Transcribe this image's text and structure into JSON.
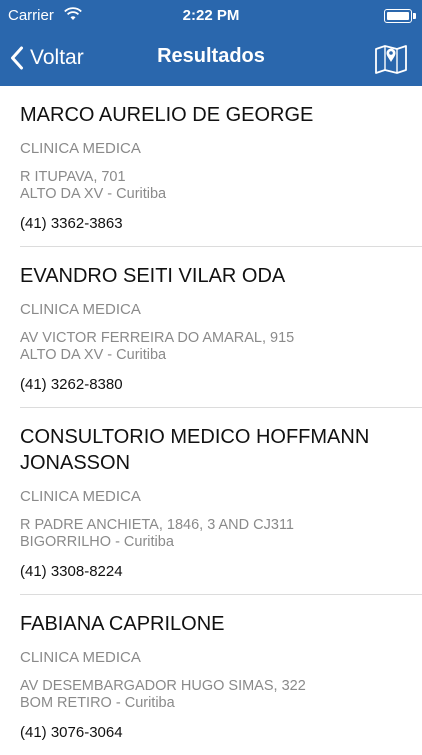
{
  "status": {
    "carrier": "Carrier",
    "time": "2:22 PM"
  },
  "nav": {
    "back_label": "Voltar",
    "title": "Resultados"
  },
  "results": [
    {
      "name": "MARCO AURELIO DE GEORGE",
      "specialty": "CLINICA MEDICA",
      "address1": "R ITUPAVA, 701",
      "address2": "ALTO DA XV - Curitiba",
      "phone": "(41) 3362-3863"
    },
    {
      "name": "EVANDRO SEITI VILAR ODA",
      "specialty": "CLINICA MEDICA",
      "address1": "AV VICTOR FERREIRA DO AMARAL, 915",
      "address2": "ALTO DA XV - Curitiba",
      "phone": "(41) 3262-8380"
    },
    {
      "name": "CONSULTORIO MEDICO HOFFMANN JONASSON",
      "specialty": "CLINICA MEDICA",
      "address1": "R PADRE ANCHIETA, 1846, 3 AND CJ311",
      "address2": "BIGORRILHO - Curitiba",
      "phone": "(41) 3308-8224"
    },
    {
      "name": "FABIANA CAPRILONE",
      "specialty": "CLINICA MEDICA",
      "address1": "AV DESEMBARGADOR HUGO SIMAS, 322",
      "address2": "BOM RETIRO - Curitiba",
      "phone": "(41) 3076-3064"
    }
  ],
  "colors": {
    "nav_background": "#2a67ad",
    "separator": "#dcdcdc",
    "secondary_text": "#8a8a8a"
  },
  "icons": {
    "wifi": "wifi-icon",
    "battery": "battery-icon",
    "back": "chevron-left-icon",
    "map": "map-pin-icon"
  }
}
